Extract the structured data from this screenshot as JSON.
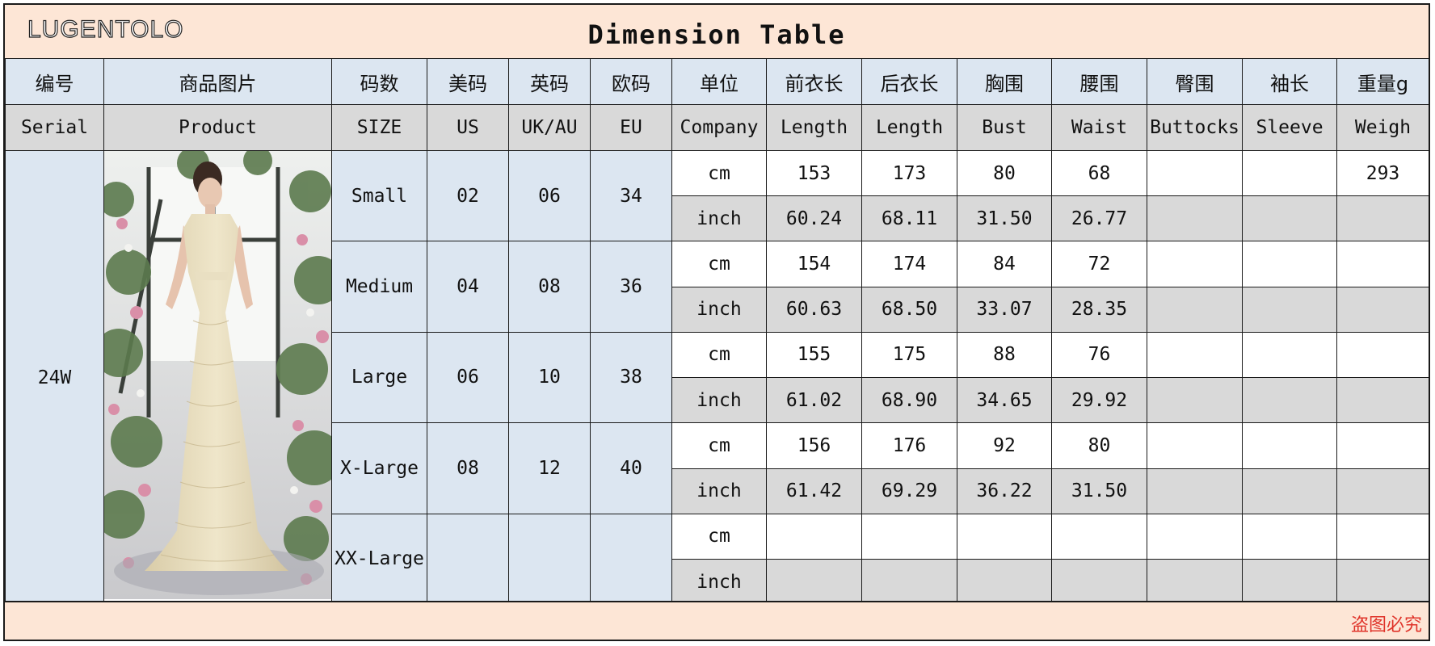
{
  "brand": "LUGENTOLO",
  "title": "Dimension Table",
  "header_cn": [
    "编号",
    "商品图片",
    "码数",
    "美码",
    "英码",
    "欧码",
    "单位",
    "前衣长",
    "后衣长",
    "胸围",
    "腰围",
    "臀围",
    "袖长",
    "重量g"
  ],
  "header_en": [
    "Serial",
    "Product",
    "SIZE",
    "US",
    "UK/AU",
    "EU",
    "Company",
    "Length",
    "Length",
    "Bust",
    "Waist",
    "Buttocks",
    "Sleeve",
    "Weigh"
  ],
  "serial": "24W",
  "sizes": [
    {
      "name": "Small",
      "us": "02",
      "uk": "06",
      "eu": "34",
      "cm": {
        "unit": "cm",
        "front": "153",
        "back": "173",
        "bust": "80",
        "waist": "68",
        "buttocks": "",
        "sleeve": "",
        "weight": "293"
      },
      "inch": {
        "unit": "inch",
        "front": "60.24",
        "back": "68.11",
        "bust": "31.50",
        "waist": "26.77",
        "buttocks": "",
        "sleeve": "",
        "weight": ""
      }
    },
    {
      "name": "Medium",
      "us": "04",
      "uk": "08",
      "eu": "36",
      "cm": {
        "unit": "cm",
        "front": "154",
        "back": "174",
        "bust": "84",
        "waist": "72",
        "buttocks": "",
        "sleeve": "",
        "weight": ""
      },
      "inch": {
        "unit": "inch",
        "front": "60.63",
        "back": "68.50",
        "bust": "33.07",
        "waist": "28.35",
        "buttocks": "",
        "sleeve": "",
        "weight": ""
      }
    },
    {
      "name": "Large",
      "us": "06",
      "uk": "10",
      "eu": "38",
      "cm": {
        "unit": "cm",
        "front": "155",
        "back": "175",
        "bust": "88",
        "waist": "76",
        "buttocks": "",
        "sleeve": "",
        "weight": ""
      },
      "inch": {
        "unit": "inch",
        "front": "61.02",
        "back": "68.90",
        "bust": "34.65",
        "waist": "29.92",
        "buttocks": "",
        "sleeve": "",
        "weight": ""
      }
    },
    {
      "name": "X-Large",
      "us": "08",
      "uk": "12",
      "eu": "40",
      "cm": {
        "unit": "cm",
        "front": "156",
        "back": "176",
        "bust": "92",
        "waist": "80",
        "buttocks": "",
        "sleeve": "",
        "weight": ""
      },
      "inch": {
        "unit": "inch",
        "front": "61.42",
        "back": "69.29",
        "bust": "36.22",
        "waist": "31.50",
        "buttocks": "",
        "sleeve": "",
        "weight": ""
      }
    },
    {
      "name": "XX-Large",
      "us": "",
      "uk": "",
      "eu": "",
      "cm": {
        "unit": "cm",
        "front": "",
        "back": "",
        "bust": "",
        "waist": "",
        "buttocks": "",
        "sleeve": "",
        "weight": ""
      },
      "inch": {
        "unit": "inch",
        "front": "",
        "back": "",
        "bust": "",
        "waist": "",
        "buttocks": "",
        "sleeve": "",
        "weight": ""
      }
    }
  ],
  "footer": "盗图必究",
  "colors": {
    "title_bg": "#fde6d6",
    "header_blue": "#dce6f1",
    "header_grey": "#d9d9d9",
    "warning_red": "#e0342a"
  }
}
